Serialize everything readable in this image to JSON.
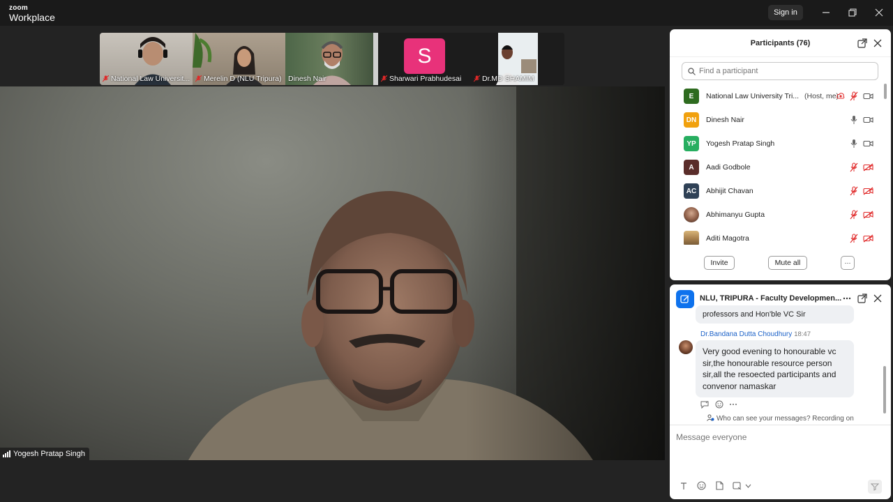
{
  "app": {
    "brand_top": "zoom",
    "brand_bottom": "Workplace",
    "sign_in": "Sign in"
  },
  "gallery": [
    {
      "name": "National Law Universit...",
      "muted": true,
      "bg": "#b9b2a8"
    },
    {
      "name": "Merelin D (NLU Tripura)",
      "muted": true,
      "bg": "#a29585"
    },
    {
      "name": "Dinesh Nair",
      "muted": false,
      "bg": "#5c6e52"
    },
    {
      "name": "Sharwari Prabhudesai",
      "muted": true,
      "initial": "S",
      "bg": "#1c1c1c",
      "avatar_color": "#e8327a"
    },
    {
      "name": "Dr.MD SHAMIM",
      "muted": true,
      "bg": "#1c1c1c"
    }
  ],
  "main_video": {
    "speaker": "Yogesh Pratap Singh"
  },
  "participants": {
    "title": "Participants (76)",
    "search_placeholder": "Find a participant",
    "list": [
      {
        "initials": "E",
        "name": "National Law University Tri...",
        "tag": "(Host, me)",
        "color": "#2e6b1f",
        "audio": "muted",
        "video": "on",
        "recording": true
      },
      {
        "initials": "DN",
        "name": "Dinesh Nair",
        "color": "#f1a10e",
        "audio": "on",
        "video": "on"
      },
      {
        "initials": "YP",
        "name": "Yogesh Pratap Singh",
        "color": "#27ae60",
        "audio": "on",
        "video": "on"
      },
      {
        "initials": "A",
        "name": "Aadi Godbole",
        "color": "#5a2d2a",
        "audio": "muted",
        "video": "off"
      },
      {
        "initials": "AC",
        "name": "Abhijit Chavan",
        "color": "#2f4156",
        "audio": "muted",
        "video": "off"
      },
      {
        "initials": "",
        "name": "Abhimanyu Gupta",
        "color": "#b98874",
        "audio": "muted",
        "video": "off"
      },
      {
        "initials": "",
        "name": "Aditi Magotra",
        "color": "#c9a46b",
        "audio": "muted",
        "video": "off"
      }
    ],
    "invite_label": "Invite",
    "mute_all_label": "Mute all",
    "more_label": "···"
  },
  "chat": {
    "title": "NLU, TRIPURA  - Faculty Developmen...",
    "prev_message_tail": "professors and Hon'ble VC Sir",
    "sender": "Dr.Bandana Dutta Choudhury",
    "time": "18:47",
    "message": "Very good evening to honourable vc sir,the honourable resource person sir,all the resoected  participants and convenor namaskar",
    "who_can_see": "Who can see your messages? Recording on",
    "input_placeholder": "Message everyone"
  },
  "colors": {
    "accent": "#0e72ed",
    "muted_red": "#e02828",
    "titlebar": "#1a1a1a"
  }
}
